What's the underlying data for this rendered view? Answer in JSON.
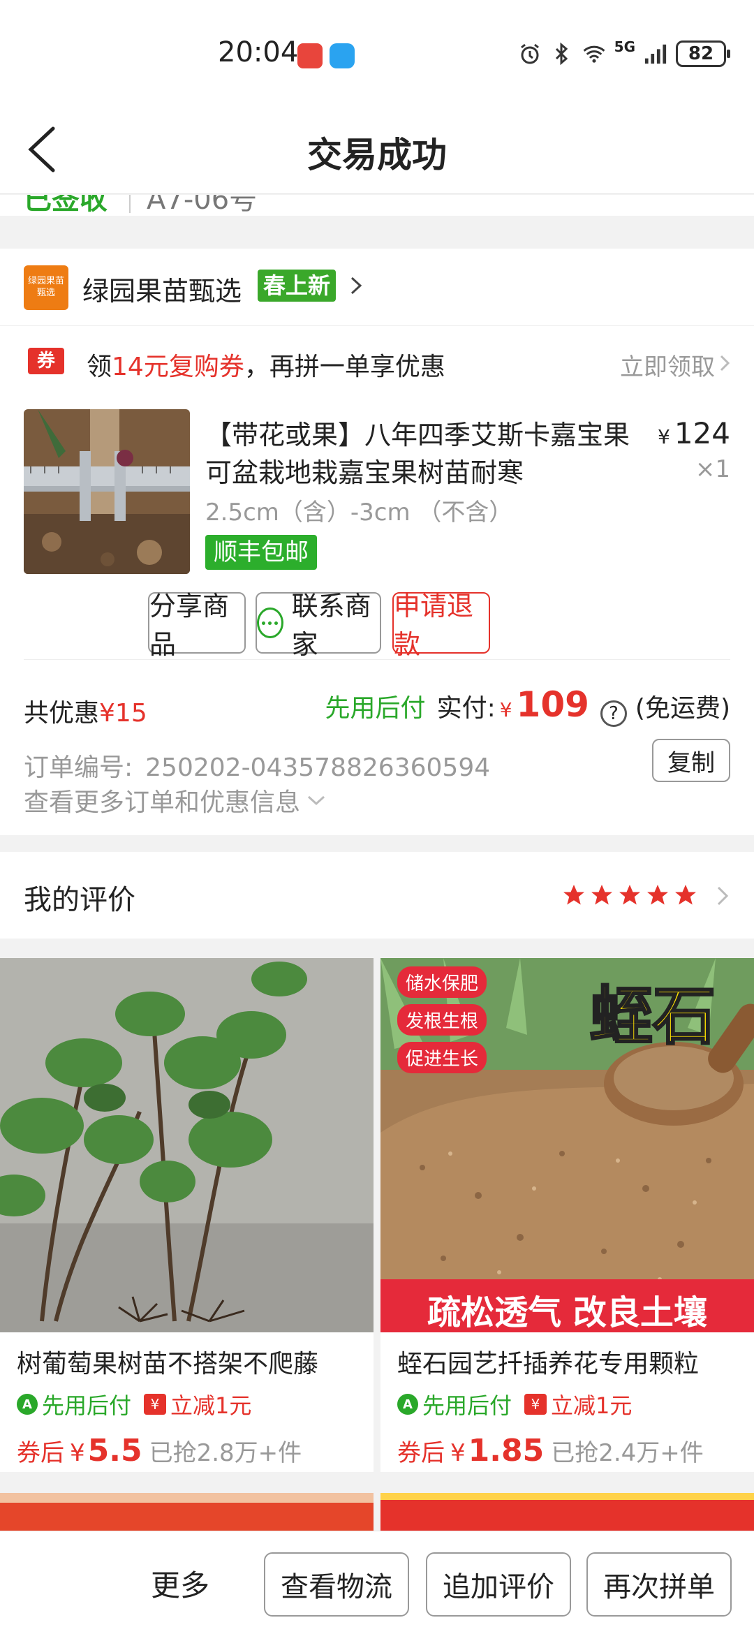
{
  "status_bar": {
    "time": "20:04",
    "network": "5G",
    "battery": "82"
  },
  "nav": {
    "title": "交易成功"
  },
  "logistics_cut": {
    "status": "已签收",
    "locker": "A7-06号"
  },
  "shop": {
    "logo_text": "绿园果苗甄选",
    "name": "绿园果苗甄选",
    "tag": "春上新"
  },
  "coupon": {
    "badge": "券",
    "prefix": "领",
    "highlight": "14元复购券",
    "suffix": "，再拼一单享优惠",
    "action": "立即领取"
  },
  "product": {
    "title": "【带花或果】八年四季艾斯卡嘉宝果可盆栽地栽嘉宝果树苗耐寒",
    "price_symbol": "¥",
    "price": "124",
    "quantity": "×1",
    "spec": "2.5cm（含）-3cm （不含）",
    "shipping_tag": "顺丰包邮"
  },
  "actions": {
    "share": "分享商品",
    "contact": "联系商家",
    "refund": "申请退款"
  },
  "payment": {
    "discount_label": "共优惠",
    "discount_value": "¥15",
    "pay_later": "先用后付",
    "paid_label": "实付:",
    "yen": "¥",
    "paid_amount": "109",
    "help_icon": "?",
    "shipping_note": "(免运费)"
  },
  "order": {
    "number_label": "订单编号:",
    "number": "250202-043578826360594",
    "copy": "复制",
    "more_info": "查看更多订单和优惠信息"
  },
  "review": {
    "label": "我的评价",
    "rating": 5,
    "star_color": "#e5322b"
  },
  "recommendations": [
    {
      "title": "树葡萄果树苗不搭架不爬藤",
      "tag_green": "先用后付",
      "tag_red": "立减1元",
      "price_prefix": "券后",
      "yen": "¥",
      "price": "5.5",
      "sold": "已抢2.8万+件"
    },
    {
      "title": "蛭石园艺扦插养花专用颗粒",
      "tag_green": "先用后付",
      "tag_red": "立减1元",
      "price_prefix": "券后",
      "yen": "¥",
      "price": "1.85",
      "sold": "已抢2.4万+件",
      "banner_title": "蛭石",
      "pills": [
        "储水保肥",
        "发根生根",
        "促进生长"
      ],
      "bottom_banner": "疏松透气 改良土壤"
    }
  ],
  "bottom_bar": {
    "more": "更多",
    "logistics": "查看物流",
    "add_review": "追加评价",
    "rebuy": "再次拼单"
  },
  "colors": {
    "brand_red": "#e5322b",
    "green": "#2aa82a"
  }
}
